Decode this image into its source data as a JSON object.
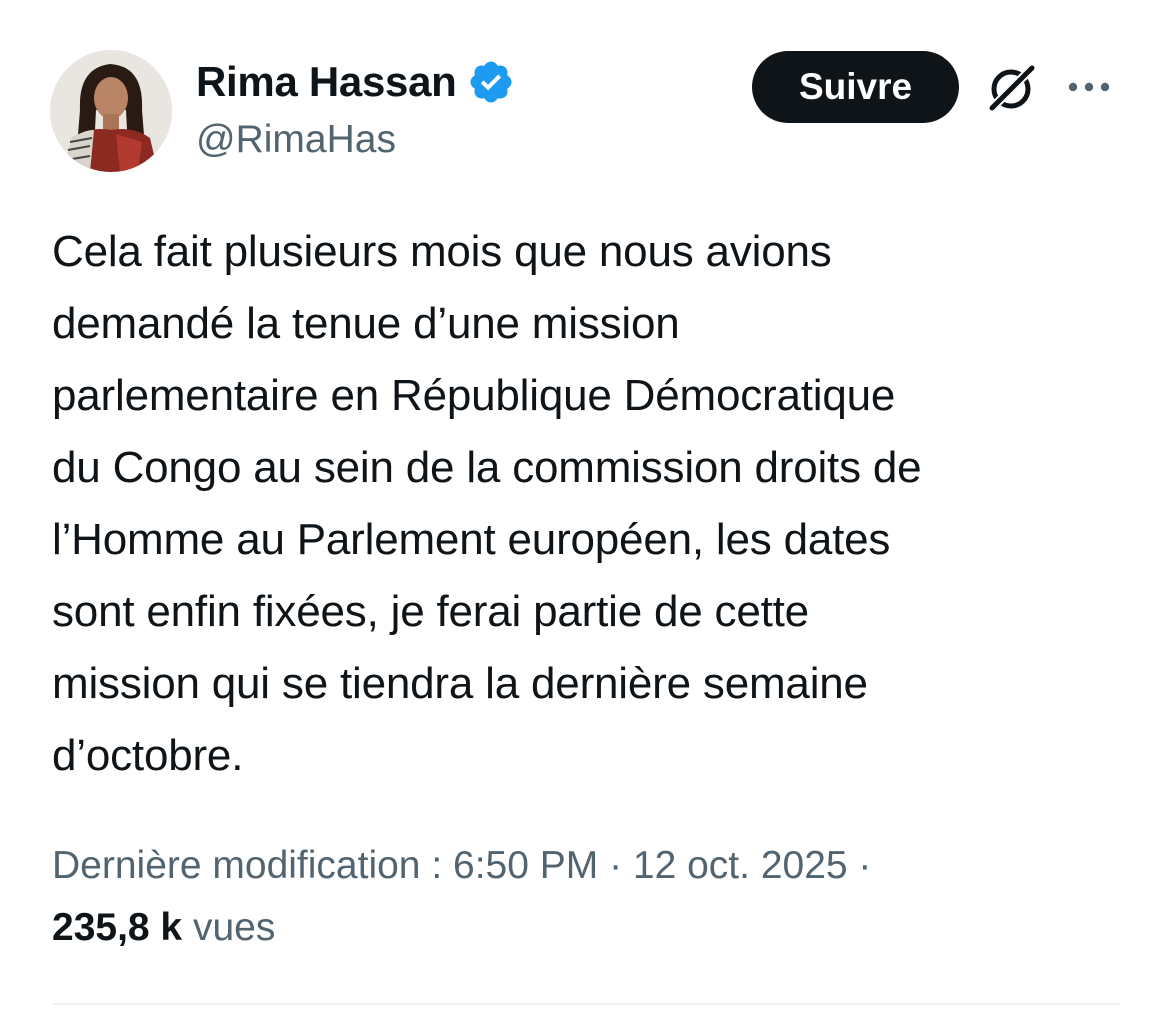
{
  "author": {
    "display_name": "Rima Hassan",
    "handle": "@RimaHas",
    "verified_badge_color": "#1d9bf0"
  },
  "actions": {
    "follow_label": "Suivre",
    "grok_icon": "grok-icon",
    "more_icon": "more-icon"
  },
  "tweet": {
    "text": "Cela fait plusieurs mois que nous avions\ndemandé la tenue d’une mission\nparlementaire en République Démocratique\ndu Congo au sein de la commission droits de\nl’Homme au Parlement européen, les dates\nsont enfin fixées, je ferai partie de cette\nmission qui se tiendra la dernière semaine\nd’octobre."
  },
  "meta": {
    "edited_label": "Dernière modification : 6:50 PM · 12 oct. 2025 ·",
    "views_count": "235,8 k",
    "views_label": "vues"
  },
  "colors": {
    "text_primary": "#0f1419",
    "text_secondary": "#536471",
    "button_bg": "#0f1419",
    "verified": "#1d9bf0",
    "divider": "#eff3f4"
  }
}
